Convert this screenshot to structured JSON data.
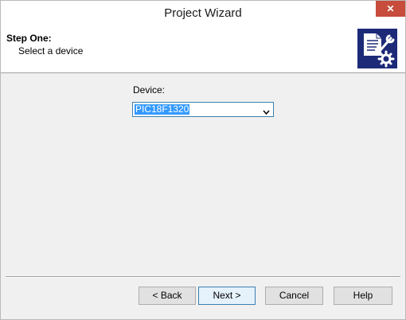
{
  "window": {
    "title": "Project Wizard",
    "close_label": "✕"
  },
  "header": {
    "step_title": "Step One:",
    "step_subtitle": "Select a device",
    "icon": "wizard-tools-icon"
  },
  "form": {
    "device_label": "Device:",
    "device_value": "PIC18F1320"
  },
  "buttons": {
    "back": "< Back",
    "next": "Next >",
    "cancel": "Cancel",
    "help": "Help"
  },
  "colors": {
    "close_button": "#c74c3c",
    "icon_background": "#1d2a78",
    "selection": "#3399ff"
  }
}
